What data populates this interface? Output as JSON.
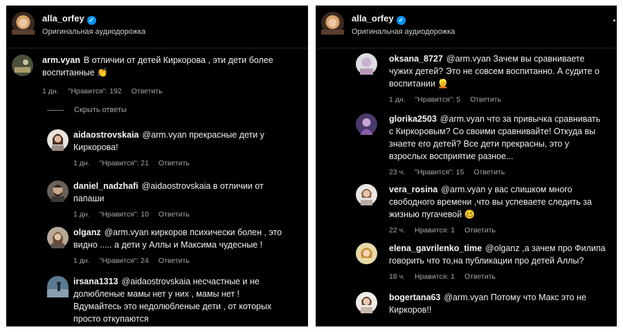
{
  "left": {
    "header": {
      "author": "alla_orfey",
      "audio": "Оригинальная аудиодорожка"
    },
    "main_comment": {
      "user": "arm.vyan",
      "text": "В отличии от детей Киркорова , эти дети более\nвоспитанные 👏",
      "time": "1 дн.",
      "likes": "\"Нравится\": 192",
      "reply": "Ответить"
    },
    "hide_replies": "Скрыть ответы",
    "replies": [
      {
        "user": "aidaostrovskaia",
        "text": "@arm.vyan прекрасные дети у\nКиркорова!",
        "time": "1 дн.",
        "likes": "\"Нравится\": 21",
        "reply": "Ответить"
      },
      {
        "user": "daniel_nadzhafi",
        "text": "@aidaostrovskaia в отличии от\nпапаши",
        "time": "1 дн.",
        "likes": "\"Нравится\": 10",
        "reply": "Ответить"
      },
      {
        "user": "olganz",
        "text": "@arm.vyan киркоров психически болен , это\nвидно ..... а дети у Аллы и Максима чудесные !",
        "time": "1 дн.",
        "likes": "\"Нравится\": 24",
        "reply": "Ответить"
      },
      {
        "user": "irsana1313",
        "text": "@aidaostrovskaia несчастные и не\nдолюбленые мамы нет у них , мамы нет !\nВдумайтесь это недолюбленые дети , от которых\nпросто откупаются"
      }
    ]
  },
  "right": {
    "header": {
      "author": "alla_orfey",
      "audio": "Оригинальная аудиодорожка"
    },
    "replies": [
      {
        "user": "oksana_8727",
        "text": "@arm.vyan Зачем вы сравниваете\nчужих детей? Это не совсем воспитанно. А судите о\nвоспитании 👱",
        "time": "1 дн.",
        "likes": "\"Нравится\": 5",
        "reply": "Ответить"
      },
      {
        "user": "glorika2503",
        "text": "@arm.vyan что за привычка сравнивать\nс Киркоровым? Со своими сравнивайте! Откуда вы\nзнаете его детей? Все дети прекрасны, это у\nвзрослых восприятие разное...",
        "time": "23 ч.",
        "likes": "\"Нравится\": 15",
        "reply": "Ответить"
      },
      {
        "user": "vera_rosina",
        "text": "@arm.vyan у вас слишком много\nсвободного времени ,что вы успеваете следить за\nжизнью пугачевой 🥴",
        "time": "22 ч.",
        "likes": "Нравится: 1",
        "reply": "Ответить"
      },
      {
        "user": "elena_gavrilenko_time",
        "text": "@olganz ,а зачем про Филипа\nговорить что то,на публикации про детей Аллы?",
        "time": "18 ч.",
        "likes": "Нравится: 1",
        "reply": "Ответить"
      },
      {
        "user": "bogertana63",
        "text": "@arm.vyan Потому что Макс это не\nКиркоров!!"
      }
    ]
  },
  "colors": {
    "background": "#000000",
    "text": "#f5f5f5",
    "meta": "#a8a8a8",
    "verified": "#0095f6"
  },
  "icons": [
    "verified-icon",
    "more-options-icon"
  ]
}
